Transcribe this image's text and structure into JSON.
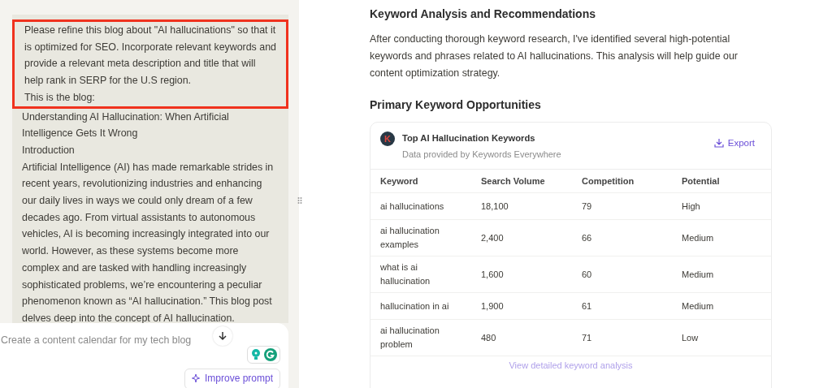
{
  "chat": {
    "message": {
      "paragraphs": [
        {
          "text": "Please refine this blog about \"AI hallucinations\" so that it is optimized for SEO. Incorporate relevant keywords and provide a relevant meta description and title that will help rank in SERP for the U.S region.",
          "highlighted": true
        },
        {
          "text": "This is the blog:",
          "highlighted": true
        },
        {
          "text": "Understanding AI Hallucination: When Artificial Intelligence Gets It Wrong",
          "highlighted": false
        },
        {
          "text": "Introduction",
          "highlighted": false
        },
        {
          "text": "Artificial Intelligence (AI) has made remarkable strides in recent years, revolutionizing industries and enhancing our daily lives in ways we could only dream of a few decades ago. From virtual assistants to autonomous vehicles, AI is becoming increasingly integrated into our world. However, as these systems become more complex and are tasked with handling increasingly sophisticated problems, we’re encountering a peculiar phenomenon known as “AI hallucination.” This blog post delves deep into the concept of AI hallucination.",
          "highlighted": false
        }
      ]
    },
    "input": {
      "placeholder": "Create a content calendar for my tech blog",
      "improve_label": "Improve prompt"
    }
  },
  "response": {
    "heading": "Keyword Analysis and Recommendations",
    "intro": "After conducting thorough keyword research, I've identified several high-potential keywords and phrases related to AI hallucinations. This analysis will help guide our content optimization strategy.",
    "subheading": "Primary Keyword Opportunities",
    "card": {
      "logo": "K",
      "title": "Top AI Hallucination Keywords",
      "subtitle": "Data provided by Keywords Everywhere",
      "export_label": "Export",
      "table": {
        "columns": [
          "Keyword",
          "Search Volume",
          "Competition",
          "Potential"
        ],
        "rows": [
          [
            "ai hallucinations",
            "18,100",
            "79",
            "High"
          ],
          [
            "ai hallucination examples",
            "2,400",
            "66",
            "Medium"
          ],
          [
            "what is ai hallucination",
            "1,600",
            "60",
            "Medium"
          ],
          [
            "hallucination in ai",
            "1,900",
            "61",
            "Medium"
          ],
          [
            "ai hallucination problem",
            "480",
            "71",
            "Low"
          ]
        ]
      },
      "link": "View detailed keyword analysis"
    }
  }
}
